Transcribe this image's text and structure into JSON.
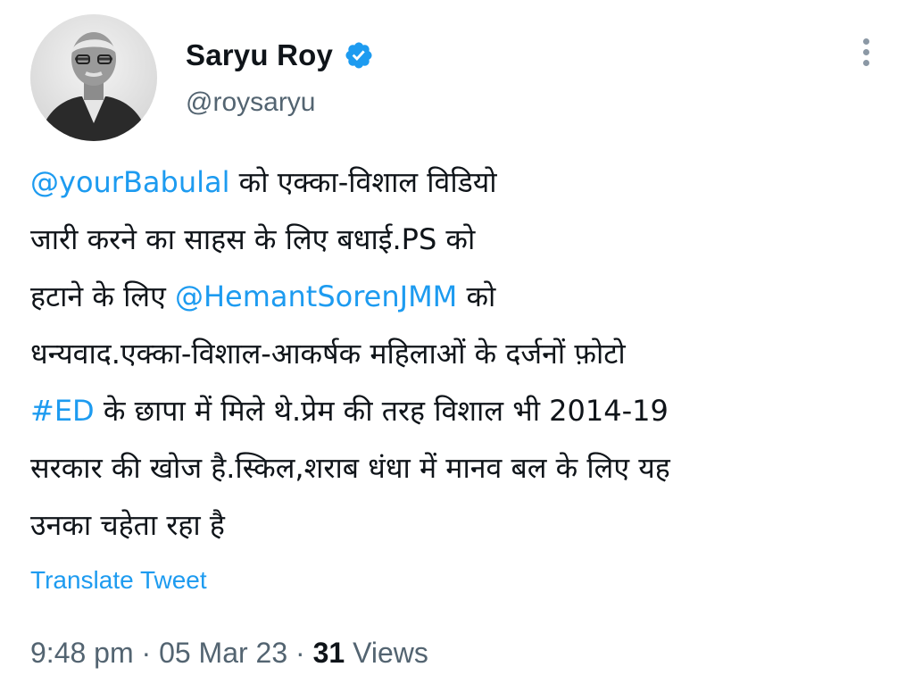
{
  "author": {
    "display_name": "Saryu Roy",
    "handle": "@roysaryu",
    "avatar_icon": "profile-photo",
    "verified_icon": "verified-badge-icon"
  },
  "menu": {
    "icon": "more-options-icon"
  },
  "tweet": {
    "lines": [
      [
        {
          "text": "@yourBabulal",
          "link": true
        },
        {
          "text": " को एक्का-विशाल विडियो"
        }
      ],
      [
        {
          "text": "जारी करने का साहस के लिए बधाई.PS को"
        }
      ],
      [
        {
          "text": "हटाने के लिए "
        },
        {
          "text": "@HemantSorenJMM",
          "link": true
        },
        {
          "text": " को"
        }
      ],
      [
        {
          "text": "धन्यवाद.एक्का-विशाल-आकर्षक महिलाओं के दर्जनों फ़ोटो"
        }
      ],
      [
        {
          "text": "#ED",
          "link": true
        },
        {
          "text": " के छापा में मिले थे.प्रेम की तरह विशाल भी 2014-19"
        }
      ],
      [
        {
          "text": "सरकार की खोज है.स्किल,शराब धंधा में मानव बल के लिए यह"
        }
      ],
      [
        {
          "text": "उनका चहेता रहा है"
        }
      ]
    ]
  },
  "translate_label": "Translate Tweet",
  "meta": {
    "time": "9:48 pm",
    "separator": " · ",
    "date": "05 Mar 23",
    "views_count": "31",
    "views_label": " Views"
  },
  "colors": {
    "link": "#1d9bf0",
    "verified": "#1d9bf0",
    "text": "#0f1419",
    "secondary": "#536471"
  }
}
